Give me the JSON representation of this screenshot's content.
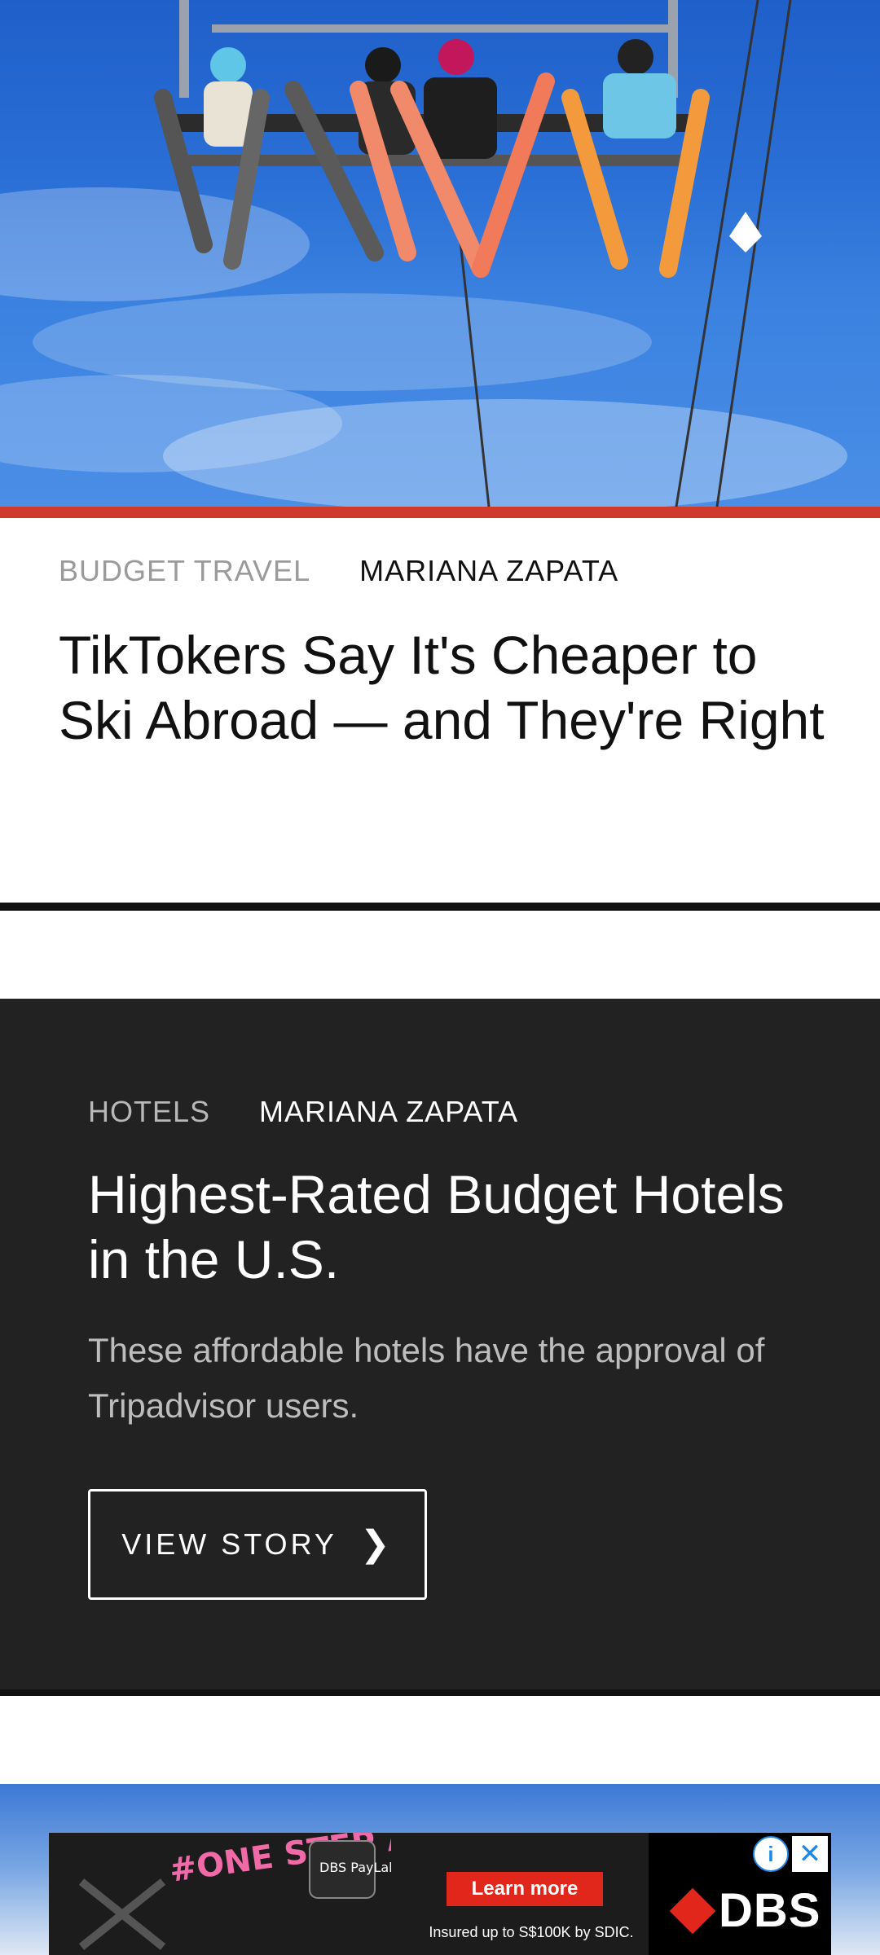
{
  "hero": {
    "image_alt": "Skiers on a chairlift against a blue sky",
    "accent_color": "#d03a2b"
  },
  "story1": {
    "category": "BUDGET TRAVEL",
    "author": "MARIANA ZAPATA",
    "headline": "TikTokers Say It's Cheaper to Ski Abroad — and They're Right"
  },
  "story2": {
    "category": "HOTELS",
    "author": "MARIANA ZAPATA",
    "headline": "Highest-Rated Budget Hotels in the U.S.",
    "dek": "These affordable hotels have the approval of Tripadvisor users.",
    "cta_label": "VIEW STORY",
    "cta_icon": "chevron-right-icon",
    "background_color": "#222222"
  },
  "ad": {
    "artwork_text": "#ONE STEP AHEAD",
    "badge_text": "DBS PayLah!",
    "cta_label": "Learn more",
    "disclaimer": "Insured up to S$100K by SDIC.",
    "brand": "DBS",
    "info_icon": "info-icon",
    "close_icon": "close-icon",
    "brand_color": "#e1261c"
  }
}
